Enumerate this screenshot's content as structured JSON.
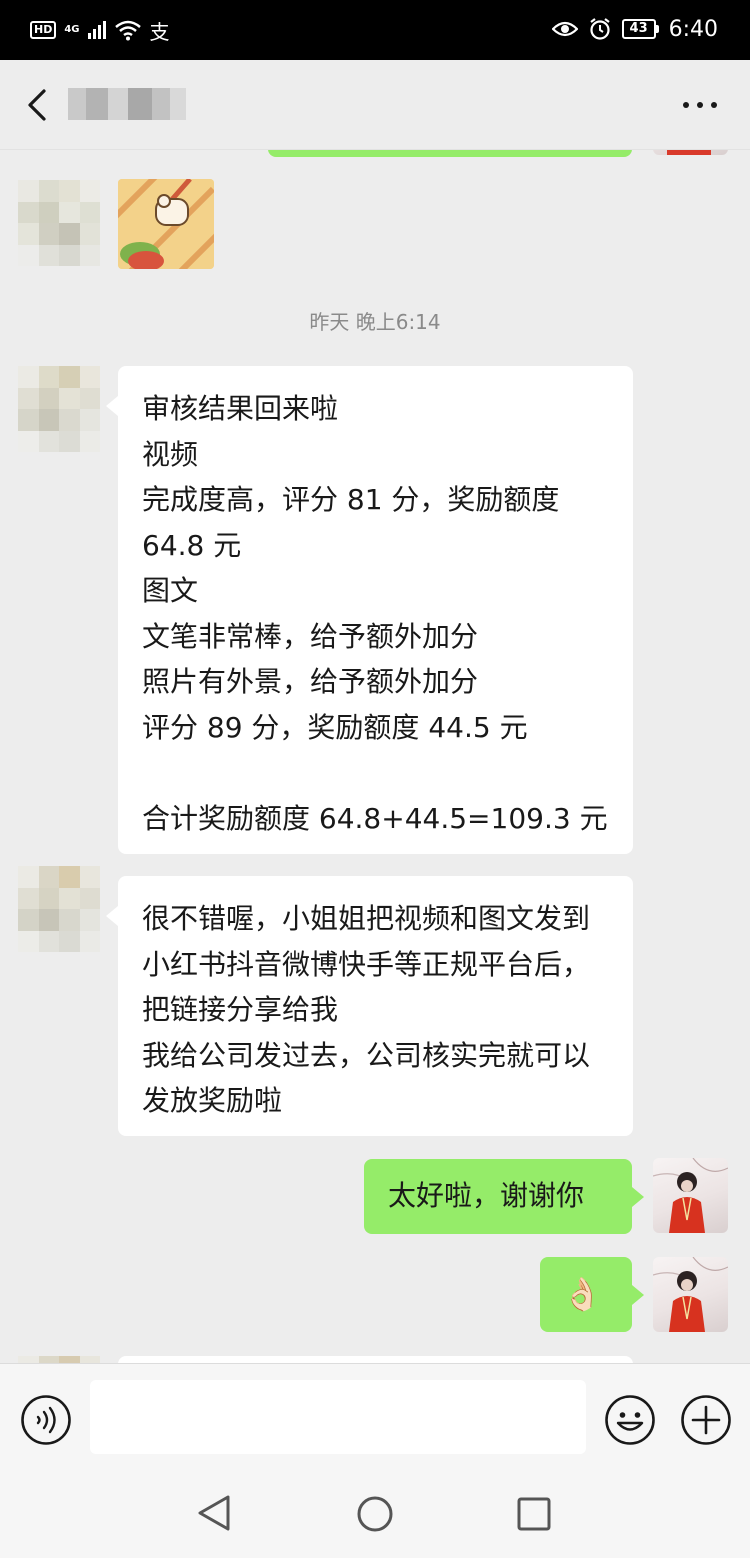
{
  "status_bar": {
    "hd": "HD",
    "network": "4G",
    "extra_icon": "支",
    "battery": "43",
    "time": "6:40"
  },
  "nav": {
    "title": "",
    "back_icon": "chevron-left-icon",
    "more_icon": "more-dots-icon"
  },
  "chat": {
    "timestamp": "昨天 晚上6:14",
    "messages": [
      {
        "from": "contact",
        "text": "审核结果回来啦\n视频\n完成度高，评分 81 分，奖励额度 64.8 元\n图文\n文笔非常棒，给予额外加分\n照片有外景，给予额外加分\n评分 89 分，奖励额度 44.5 元\n\n合计奖励额度 64.8+44.5=109.3 元"
      },
      {
        "from": "contact",
        "text": "很不错喔，小姐姐把视频和图文发到小红书抖音微博快手等正规平台后，把链接分享给我\n我给公司发过去，公司核实完就可以发放奖励啦"
      },
      {
        "from": "me",
        "text": "太好啦，谢谢你"
      },
      {
        "from": "me",
        "text": "👌🏻"
      }
    ]
  },
  "input_bar": {
    "voice_icon": "voice-icon",
    "input_value": "",
    "emoji_icon": "emoji-icon",
    "plus_icon": "plus-icon"
  },
  "system_nav": {
    "back": "triangle-back-icon",
    "home": "circle-home-icon",
    "recent": "square-recent-icon"
  },
  "colors": {
    "outgoing_bubble": "#95ec69",
    "incoming_bubble": "#ffffff",
    "background": "#ededed"
  }
}
